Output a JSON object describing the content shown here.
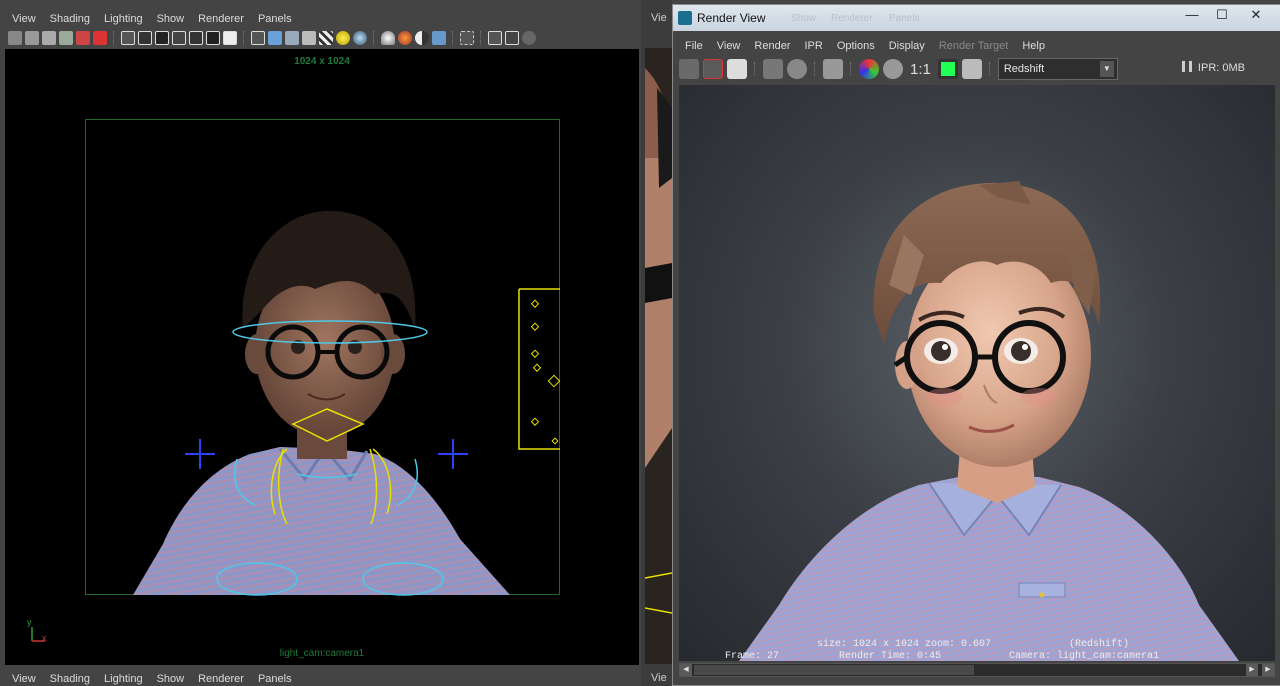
{
  "left_panel": {
    "menu": [
      "View",
      "Shading",
      "Lighting",
      "Show",
      "Renderer",
      "Panels"
    ],
    "resolution_label": "1024 x 1024",
    "camera_label": "light_cam:camera1",
    "axis_y": "y",
    "axis_x": "x",
    "bottom_menu": [
      "View",
      "Shading",
      "Lighting",
      "Show",
      "Renderer",
      "Panels"
    ]
  },
  "middle_panel": {
    "menu_label": "Vie",
    "bottom_menu_label": "Vie"
  },
  "render_view": {
    "title": "Render View",
    "ghost_menu": [
      "Show",
      "Renderer",
      "Panels"
    ],
    "menu": [
      "File",
      "View",
      "Render",
      "IPR",
      "Options",
      "Display",
      "Render Target",
      "Help"
    ],
    "disabled_menu": "Render Target",
    "ratio_label": "1:1",
    "renderer_select": "Redshift",
    "ipr_label": "IPR: 0MB",
    "info": {
      "size": "size: 1024 x 1024 zoom: 0.607",
      "engine": "(Redshift)",
      "frame": "Frame: 27",
      "render_time": "Render Time: 0:45",
      "camera": "Camera: light_cam:camera1"
    }
  },
  "colors": {
    "ui_bg": "#444444",
    "viewport_bg": "#000000",
    "gate": "#1e6a2e",
    "control_yellow": "#e8e000",
    "control_cyan": "#4fc8e8",
    "control_blue": "#2f3fff"
  }
}
